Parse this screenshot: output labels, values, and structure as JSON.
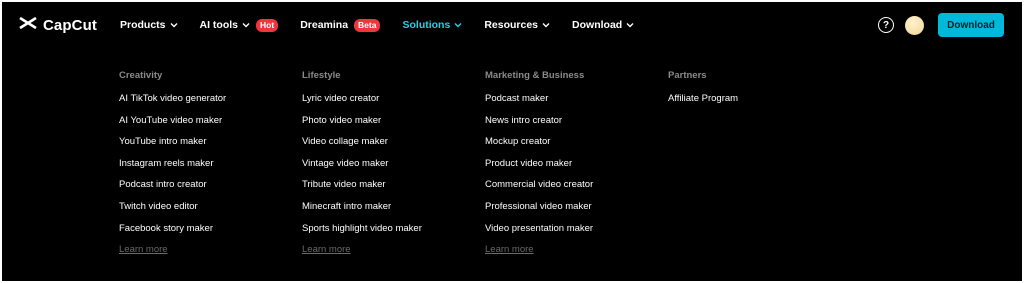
{
  "brand": {
    "name": "CapCut"
  },
  "nav": {
    "products": "Products",
    "ai_tools": "AI tools",
    "ai_tools_badge": "Hot",
    "dreamina": "Dreamina",
    "dreamina_badge": "Beta",
    "solutions": "Solutions",
    "resources": "Resources",
    "download": "Download"
  },
  "toolbar": {
    "help_symbol": "?",
    "download_button": "Download"
  },
  "menu": {
    "columns": [
      {
        "title": "Creativity",
        "items": [
          "AI TikTok video generator",
          "AI YouTube video maker",
          "YouTube intro maker",
          "Instagram reels maker",
          "Podcast intro creator",
          "Twitch video editor",
          "Facebook story maker"
        ],
        "learn_more": "Learn more"
      },
      {
        "title": "Lifestyle",
        "items": [
          "Lyric video creator",
          "Photo video maker",
          "Video collage maker",
          "Vintage video maker",
          "Tribute video maker",
          "Minecraft intro maker",
          "Sports highlight video maker"
        ],
        "learn_more": "Learn more"
      },
      {
        "title": "Marketing & Business",
        "items": [
          "Podcast maker",
          "News intro creator",
          "Mockup creator",
          "Product video maker",
          "Commercial video creator",
          "Professional video maker",
          "Video presentation maker"
        ],
        "learn_more": "Learn more"
      },
      {
        "title": "Partners",
        "items": [
          "Affiliate Program"
        ]
      }
    ]
  },
  "colors": {
    "background": "#000000",
    "accent": "#21d2e6",
    "button": "#00b8d9",
    "badge": "#f0363d"
  }
}
